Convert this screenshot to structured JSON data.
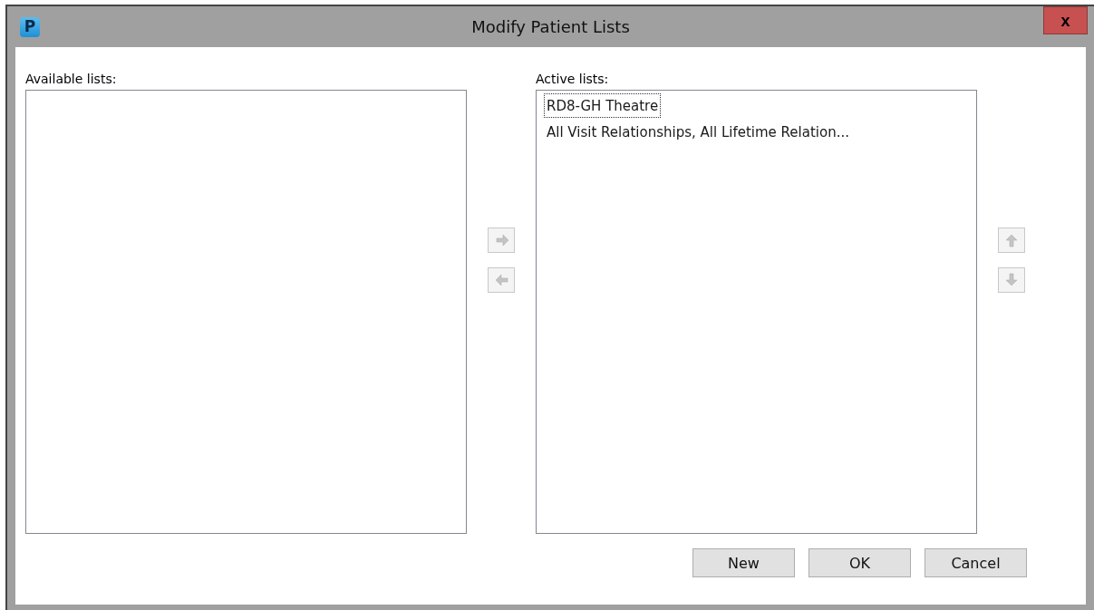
{
  "window": {
    "title": "Modify Patient Lists",
    "app_icon": "P",
    "close": "x"
  },
  "available": {
    "label": "Available lists:"
  },
  "transfer_buttons": [
    {
      "kind": "right",
      "disabled": true
    },
    {
      "kind": "left",
      "disabled": true
    }
  ],
  "active": {
    "label": "Active lists:",
    "items": [
      {
        "text": "RD8-GH Theatre",
        "focused": true
      },
      {
        "text": "All Visit Relationships, All Lifetime Relation...",
        "focused": false
      }
    ]
  },
  "order_buttons": [
    {
      "kind": "up",
      "disabled": true
    },
    {
      "kind": "down",
      "disabled": true
    }
  ],
  "buttons": [
    "New",
    "OK",
    "Cancel"
  ]
}
